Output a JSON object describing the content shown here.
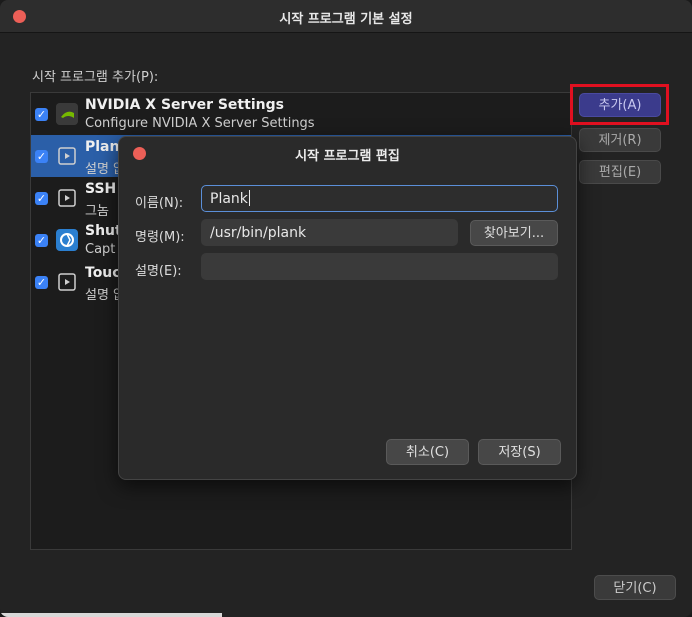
{
  "window": {
    "title": "시작 프로그램 기본 설정",
    "list_label": "시작 프로그램 추가(P):",
    "close_label": "닫기(C)"
  },
  "side_buttons": {
    "add": "추가(A)",
    "remove": "제거(R)",
    "edit": "편집(E)"
  },
  "programs": [
    {
      "title": "NVIDIA X Server Settings",
      "desc": "Configure NVIDIA X Server Settings",
      "checked": true,
      "icon": "nvidia-icon"
    },
    {
      "title": "Plan",
      "desc": "설명 없",
      "checked": true,
      "icon": "app-generic-icon",
      "selected": true
    },
    {
      "title": "SSH",
      "desc": "그놈 ",
      "checked": true,
      "icon": "app-generic-icon"
    },
    {
      "title": "Shut",
      "desc": "Capt",
      "checked": true,
      "icon": "shutter-icon"
    },
    {
      "title": "Touc",
      "desc": "설명 없",
      "checked": true,
      "icon": "app-generic-icon"
    }
  ],
  "dialog": {
    "title": "시작 프로그램 편집",
    "name_label": "이름(N):",
    "name_value": "Plank",
    "command_label": "명령(M):",
    "command_value": "/usr/bin/plank",
    "browse_label": "찾아보기...",
    "comment_label": "설명(E):",
    "comment_value": "",
    "cancel_label": "취소(C)",
    "save_label": "저장(S)"
  },
  "colors": {
    "accent": "#3b82f6",
    "selection": "#2b5fa8",
    "add_button": "#3b3b8c",
    "highlight_box": "#e01020",
    "close_dot": "#ec5f57"
  }
}
